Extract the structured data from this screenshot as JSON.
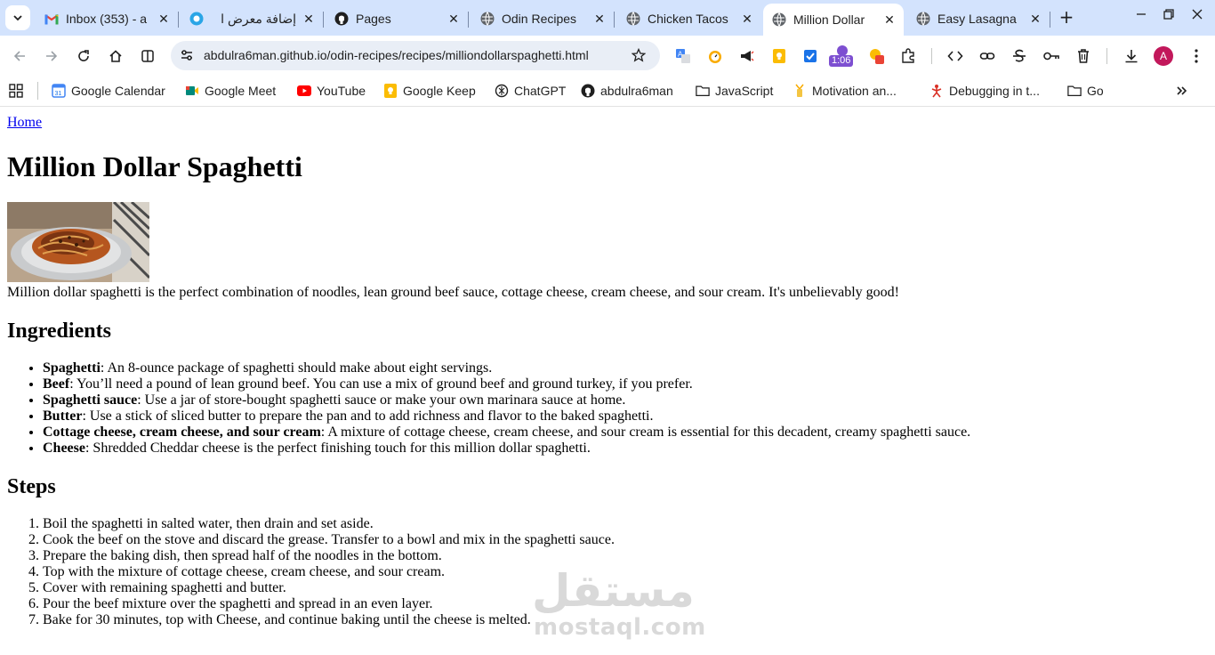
{
  "browser": {
    "tabs": [
      {
        "title": "Inbox (353) - a",
        "favicon": "gmail-icon",
        "active": false
      },
      {
        "title": "إضافة معرض ا",
        "favicon": "mostaql-icon",
        "active": false
      },
      {
        "title": "Pages",
        "favicon": "github-icon",
        "active": false
      },
      {
        "title": "Odin Recipes",
        "favicon": "globe-icon",
        "active": false
      },
      {
        "title": "Chicken Tacos",
        "favicon": "globe-icon",
        "active": false
      },
      {
        "title": "Million Dollar",
        "favicon": "globe-icon",
        "active": true
      },
      {
        "title": "Easy Lasagna",
        "favicon": "globe-icon",
        "active": false
      }
    ],
    "url": "abdulra6man.github.io/odin-recipes/recipes/milliondollarspaghetti.html",
    "timer_badge": "1:06",
    "profile_initial": "A",
    "bookmarks": [
      {
        "label": "Google Calendar",
        "icon": "google-calendar-icon"
      },
      {
        "label": "Google Meet",
        "icon": "google-meet-icon"
      },
      {
        "label": "YouTube",
        "icon": "youtube-icon"
      },
      {
        "label": "Google Keep",
        "icon": "google-keep-icon"
      },
      {
        "label": "ChatGPT",
        "icon": "chatgpt-icon"
      },
      {
        "label": "abdulra6man",
        "icon": "github-icon"
      },
      {
        "label": "JavaScript",
        "icon": "folder-icon"
      },
      {
        "label": "Motivation an...",
        "icon": "motivation-icon"
      },
      {
        "label": "Debugging in t...",
        "icon": "debugging-icon"
      },
      {
        "label": "Go",
        "icon": "folder-icon"
      }
    ]
  },
  "page": {
    "home_link": "Home",
    "title": "Million Dollar Spaghetti",
    "image_alt": "spaghetti-dish-photo",
    "intro": "Million dollar spaghetti is the perfect combination of noodles, lean ground beef sauce, cottage cheese, cream cheese, and sour cream. It's unbelievably good!",
    "ingredients_heading": "Ingredients",
    "ingredients": [
      {
        "name": "Spaghetti",
        "text": ": An 8-ounce package of spaghetti should make about eight servings."
      },
      {
        "name": "Beef",
        "text": ": You’ll need a pound of lean ground beef. You can use a mix of ground beef and ground turkey, if you prefer."
      },
      {
        "name": "Spaghetti sauce",
        "text": ": Use a jar of store-bought spaghetti sauce or make your own marinara sauce at home."
      },
      {
        "name": "Butter",
        "text": ": Use a stick of sliced butter to prepare the pan and to add richness and flavor to the baked spaghetti."
      },
      {
        "name": "Cottage cheese, cream cheese, and sour cream",
        "text": ": A mixture of cottage cheese, cream cheese, and sour cream is essential for this decadent, creamy spaghetti sauce."
      },
      {
        "name": "Cheese",
        "text": ": Shredded Cheddar cheese is the perfect finishing touch for this million dollar spaghetti."
      }
    ],
    "steps_heading": "Steps",
    "steps": [
      "Boil the spaghetti in salted water, then drain and set aside.",
      "Cook the beef on the stove and discard the grease. Transfer to a bowl and mix in the spaghetti sauce.",
      "Prepare the baking dish, then spread half of the noodles in the bottom.",
      "Top with the mixture of cottage cheese, cream cheese, and sour cream.",
      "Cover with remaining spaghetti and butter.",
      "Pour the beef mixture over the spaghetti and spread in an even layer.",
      "Bake for 30 minutes, top with Cheese, and continue baking until the cheese is melted."
    ]
  },
  "watermark": {
    "arabic": "مستقل",
    "latin": "mostaql.com"
  }
}
